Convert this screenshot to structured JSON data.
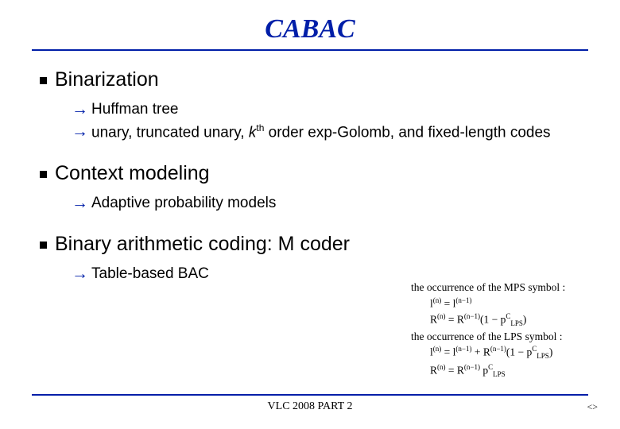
{
  "title": "CABAC",
  "sections": [
    {
      "heading": "Binarization",
      "items": [
        {
          "html": "Huffman tree"
        },
        {
          "html": "unary, truncated unary, <span class='ital'>k</span><sup>th</sup> order exp-Golomb, and fixed-length codes"
        }
      ]
    },
    {
      "heading": "Context modeling",
      "items": [
        {
          "html": "Adaptive probability models"
        }
      ]
    },
    {
      "heading": "Binary arithmetic coding: M coder",
      "items": [
        {
          "html": "Table-based BAC"
        }
      ]
    }
  ],
  "math": {
    "line1": "the occurrence of the MPS symbol :",
    "eq1": "l<sup>(n)</sup> = l<sup>(n−1)</sup>",
    "eq2": "R<sup>(n)</sup> = R<sup>(n−1)</sup>(1 − p<sup>C</sup><sub>LPS</sub>)",
    "line2": "the occurrence of the LPS symbol :",
    "eq3": "l<sup>(n)</sup> = l<sup>(n−1)</sup> + R<sup>(n−1)</sup>(1 − p<sup>C</sup><sub>LPS</sub>)",
    "eq4": "R<sup>(n)</sup> = R<sup>(n−1)</sup> p<sup>C</sup><sub>LPS</sub>"
  },
  "footer": "VLC 2008 PART 2",
  "nav": "<>"
}
